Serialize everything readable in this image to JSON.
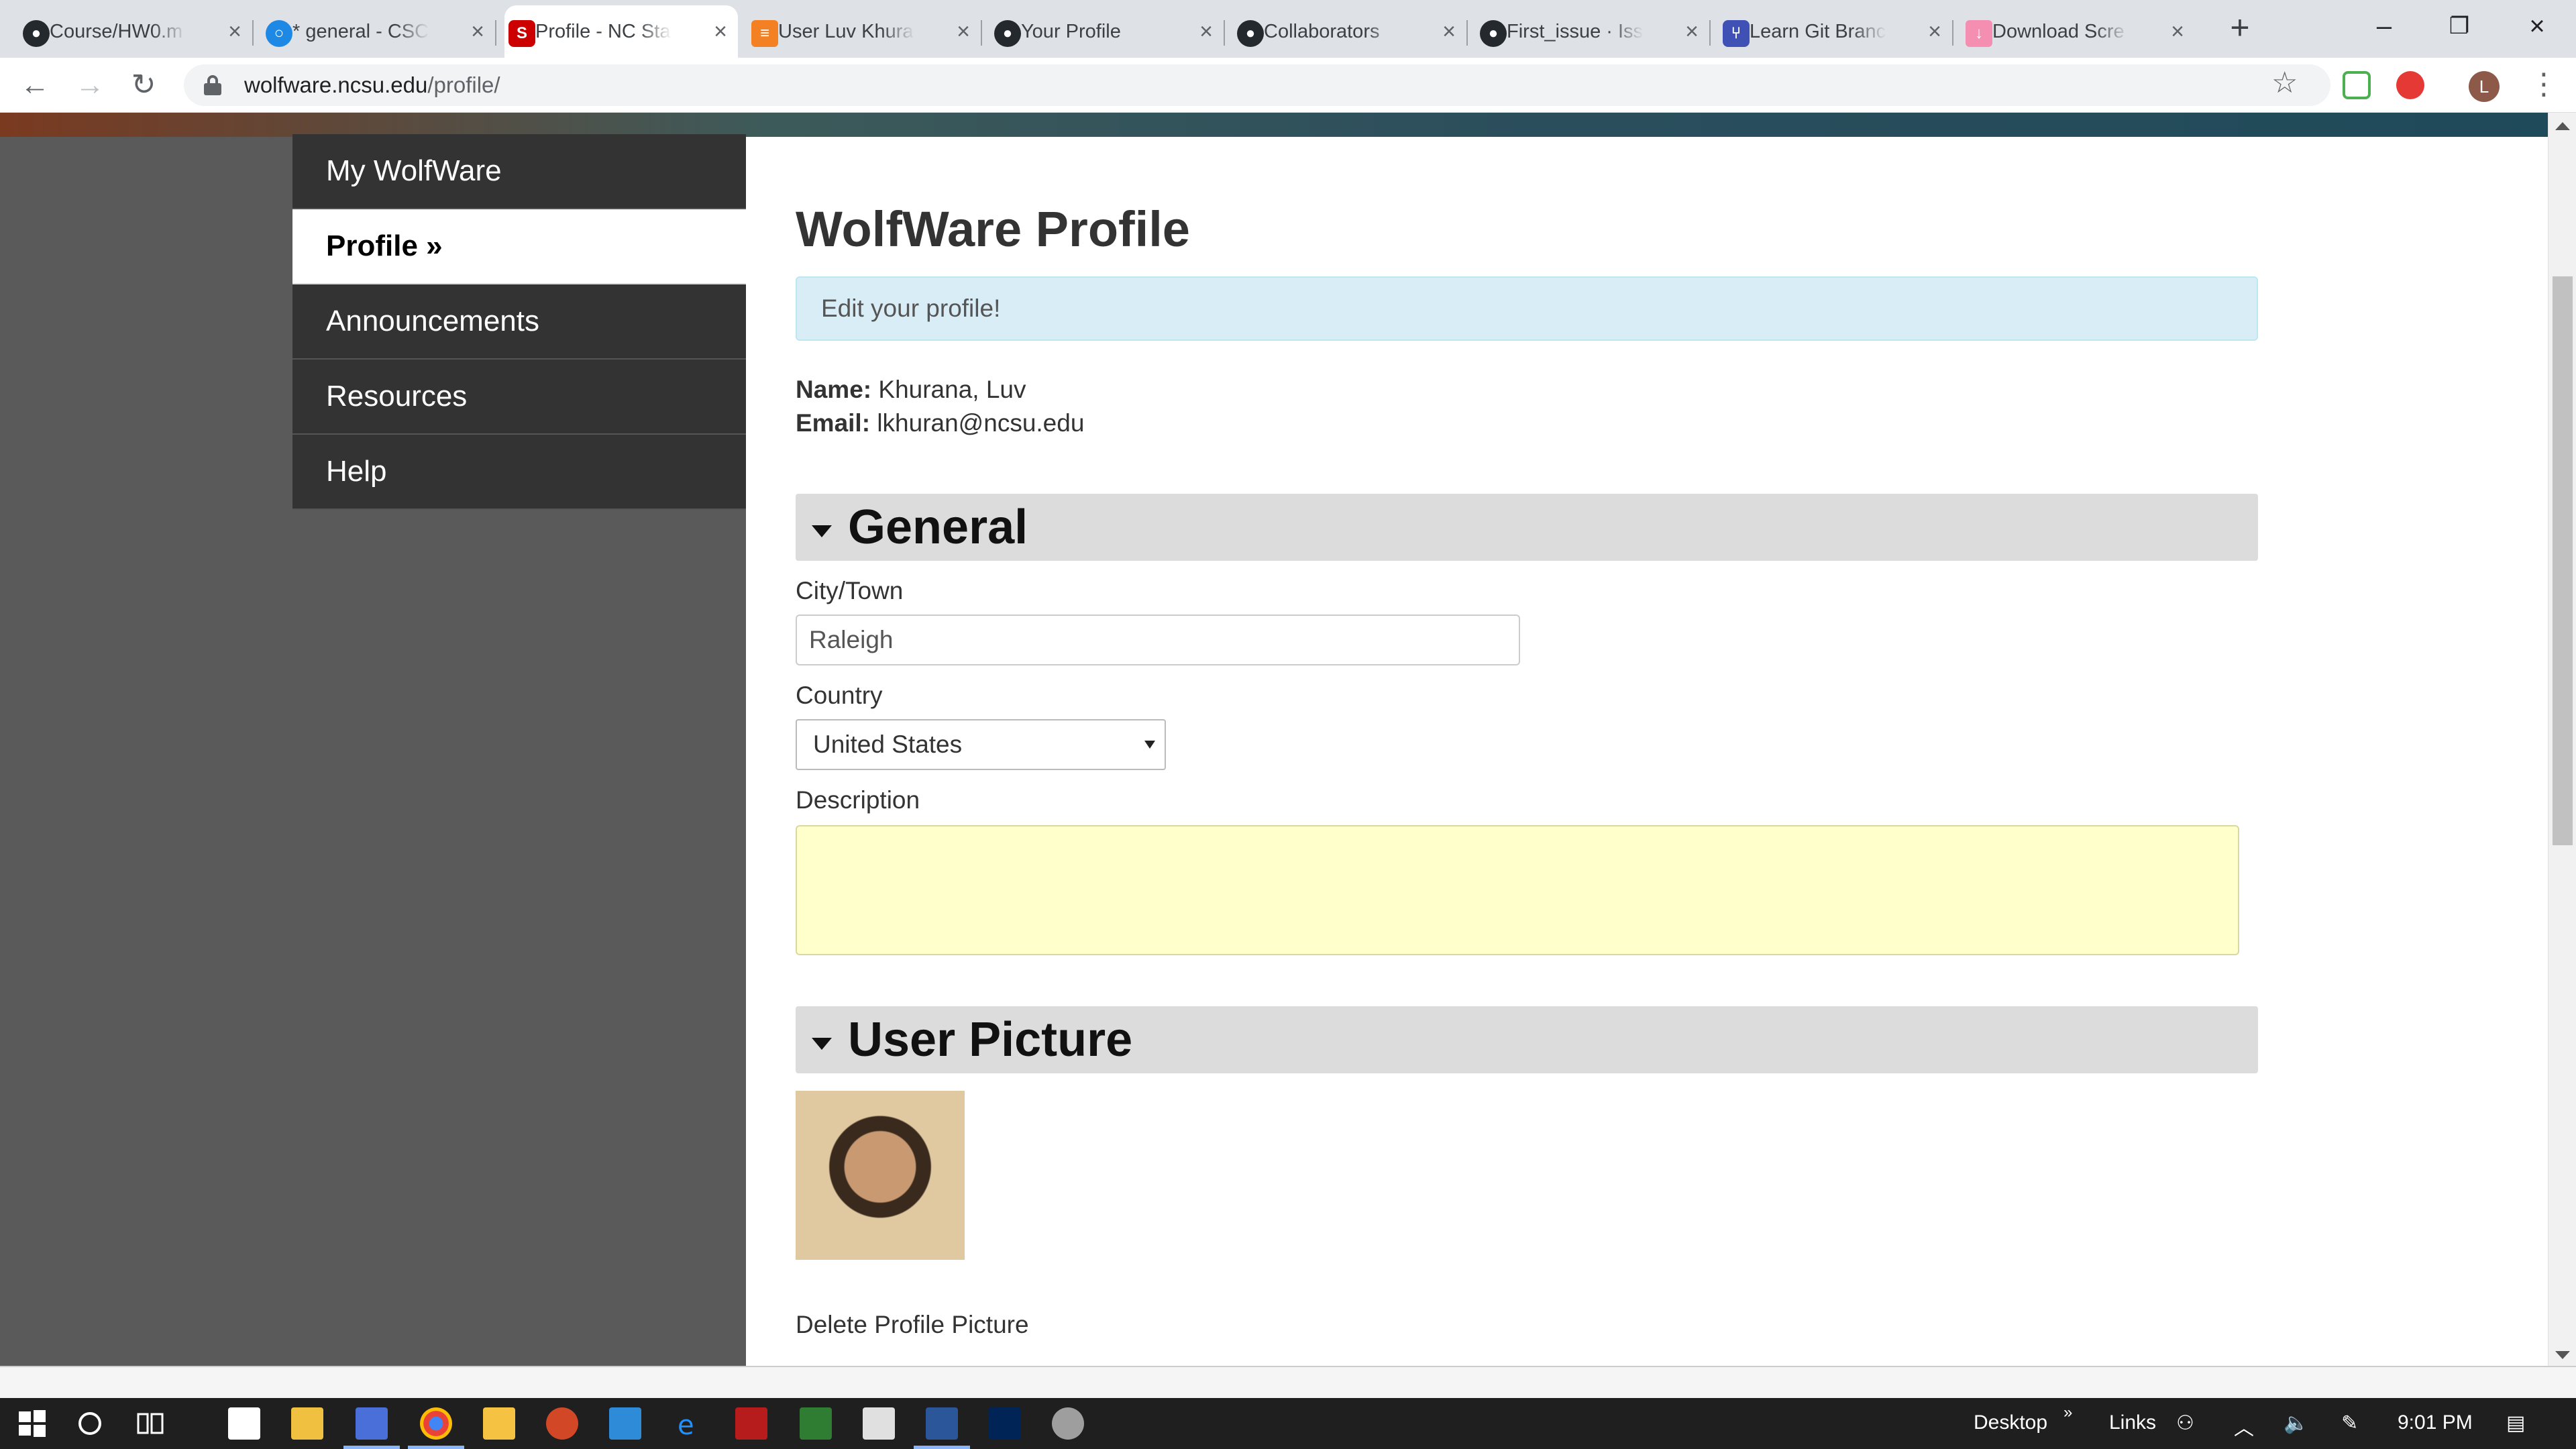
{
  "browser": {
    "tabs": [
      {
        "title": "Course/HW0.m",
        "icon": "github-icon",
        "active": false
      },
      {
        "title": "* general - CSC",
        "icon": "chat-icon",
        "active": false
      },
      {
        "title": "Profile - NC Sta",
        "icon": "ncsu-icon",
        "active": true
      },
      {
        "title": "User Luv Khura",
        "icon": "stackoverflow-icon",
        "active": false
      },
      {
        "title": "Your Profile",
        "icon": "github-icon",
        "active": false
      },
      {
        "title": "Collaborators",
        "icon": "github-icon",
        "active": false
      },
      {
        "title": "First_issue · Issu",
        "icon": "github-icon",
        "active": false
      },
      {
        "title": "Learn Git Branc",
        "icon": "branch-icon",
        "active": false
      },
      {
        "title": "Download Scre",
        "icon": "download-icon",
        "active": false
      }
    ],
    "url_host": "wolfware.ncsu.edu",
    "url_path": "/profile/",
    "avatar_letter": "L"
  },
  "sidebar": {
    "items": [
      {
        "label": "My WolfWare",
        "current": false
      },
      {
        "label": "Profile »",
        "current": true
      },
      {
        "label": "Announcements",
        "current": false
      },
      {
        "label": "Resources",
        "current": false
      },
      {
        "label": "Help",
        "current": false
      }
    ]
  },
  "profile": {
    "title": "WolfWare Profile",
    "alert": "Edit your profile!",
    "name_label": "Name:",
    "name_value": "Khurana, Luv",
    "email_label": "Email:",
    "email_value": "lkhuran@ncsu.edu",
    "general_heading": "General",
    "city_label": "City/Town",
    "city_value": "Raleigh",
    "country_label": "Country",
    "country_value": "United States",
    "description_label": "Description",
    "description_value": "",
    "picture_heading": "User Picture",
    "delete_picture": "Delete Profile Picture"
  },
  "taskbar": {
    "desktop_label": "Desktop",
    "links_label": "Links",
    "time": "9:01 PM"
  },
  "colors": {
    "sidebar_bg": "#333333",
    "alert_bg": "#d9edf7",
    "section_bg": "#dcdcdc",
    "textarea_bg": "#ffffcc"
  }
}
